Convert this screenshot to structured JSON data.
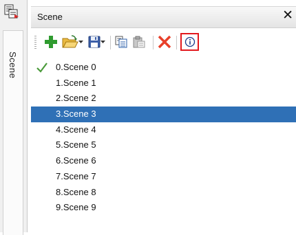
{
  "rail": {
    "tab_label": "Scene"
  },
  "panel": {
    "title": "Scene",
    "close_glyph": "✕"
  },
  "toolbar": {
    "buttons": [
      {
        "name": "add-scene-button",
        "icon": "plus-icon"
      },
      {
        "name": "open-dropdown-button",
        "icon": "folder-open-icon"
      },
      {
        "name": "save-dropdown-button",
        "icon": "floppy-disk-icon"
      },
      {
        "name": "copy-button",
        "icon": "copy-icon"
      },
      {
        "name": "paste-button",
        "icon": "paste-icon"
      },
      {
        "name": "delete-button",
        "icon": "delete-x-icon"
      },
      {
        "name": "info-button",
        "icon": "info-icon"
      }
    ]
  },
  "scenes": [
    {
      "label": "0.Scene 0",
      "active": true
    },
    {
      "label": "1.Scene 1"
    },
    {
      "label": "2.Scene 2"
    },
    {
      "label": "3.Scene 3",
      "selected": true
    },
    {
      "label": "4.Scene 4"
    },
    {
      "label": "5.Scene 5"
    },
    {
      "label": "6.Scene 6"
    },
    {
      "label": "7.Scene 7"
    },
    {
      "label": "8.Scene 8"
    },
    {
      "label": "9.Scene 9"
    }
  ],
  "colors": {
    "selection": "#2f70b6",
    "highlight_border": "#e2171c",
    "add_icon": "#2f9b2f",
    "delete_icon": "#e8402a"
  }
}
